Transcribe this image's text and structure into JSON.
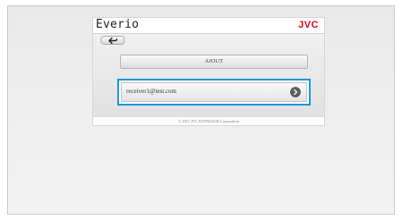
{
  "app": {
    "title": "Everio",
    "brand": "JVC"
  },
  "toolbar": {
    "back_icon": "back-arrow-icon"
  },
  "main": {
    "add_button_label": "AJOUT",
    "recipients": [
      {
        "address": "receiver1@test.com",
        "icon": "chevron-right-icon",
        "selected": true
      }
    ]
  },
  "footer": {
    "copyright": "© 2011 JVC KENWOOD Corporation"
  },
  "colors": {
    "brand": "#e2001a",
    "selection_border": "#1e95d8"
  }
}
